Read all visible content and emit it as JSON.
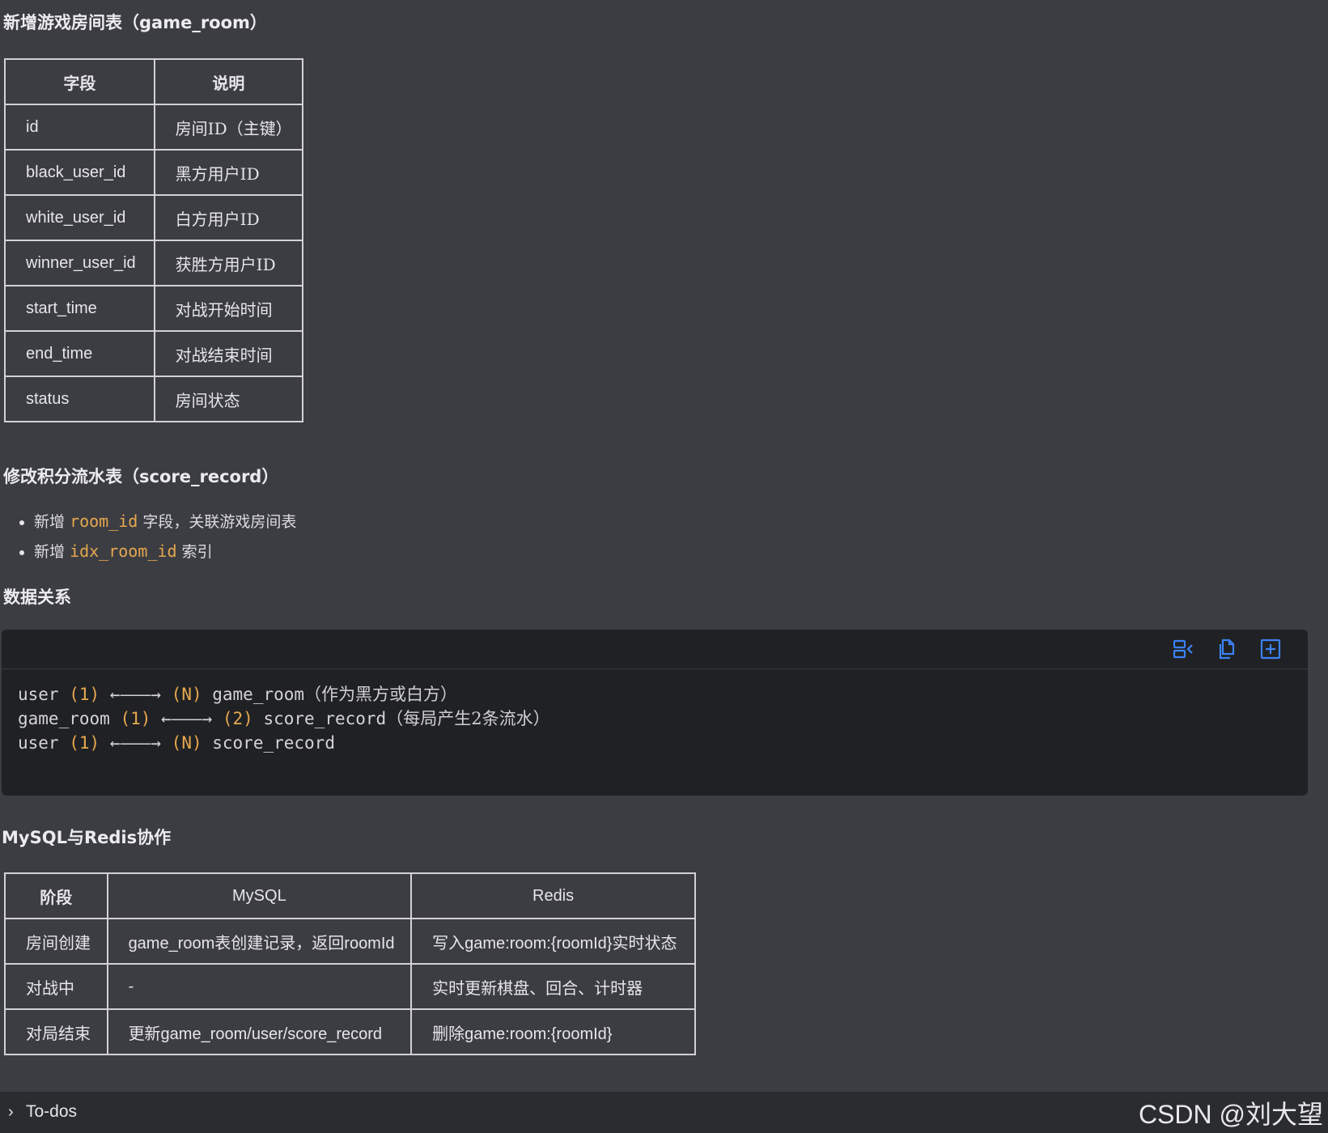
{
  "sections": {
    "game_room_title": "新增游戏房间表（game_room）",
    "score_title": "修改积分流水表（score_record）",
    "relations_title": "数据关系",
    "mysql_redis_title": "MySQL与Redis协作"
  },
  "game_room_table": {
    "headers": [
      "字段",
      "说明"
    ],
    "rows": [
      [
        "id",
        "房间ID（主键）"
      ],
      [
        "black_user_id",
        "黑方用户ID"
      ],
      [
        "white_user_id",
        "白方用户ID"
      ],
      [
        "winner_user_id",
        "获胜方用户ID"
      ],
      [
        "start_time",
        "对战开始时间"
      ],
      [
        "end_time",
        "对战结束时间"
      ],
      [
        "status",
        "房间状态"
      ]
    ]
  },
  "score_bullets": [
    {
      "prefix": "新增",
      "code": "room_id",
      "suffix": "字段，关联游戏房间表"
    },
    {
      "prefix": "新增",
      "code": "idx_room_id",
      "suffix": "索引"
    }
  ],
  "code_block": {
    "toolbar_icons": [
      "wrap-lines-icon",
      "copy-icon",
      "expand-icon"
    ],
    "lines": [
      {
        "a": "user ",
        "na": "(1)",
        "arrow": " ←———→ ",
        "nb": "(N)",
        "b": " game_room",
        "note": "（作为黑方或白方）"
      },
      {
        "a": "game_room ",
        "na": "(1)",
        "arrow": " ←———→ ",
        "nb": "(2)",
        "b": " score_record",
        "note": "（每局产生2条流水）"
      },
      {
        "a": "user ",
        "na": "(1)",
        "arrow": " ←———→ ",
        "nb": "(N)",
        "b": " score_record",
        "note": ""
      }
    ]
  },
  "mysql_redis_table": {
    "headers": [
      "阶段",
      "MySQL",
      "Redis"
    ],
    "rows": [
      [
        "房间创建",
        "game_room表创建记录，返回roomId",
        "写入game:room:{roomId}实时状态"
      ],
      [
        "对战中",
        "-",
        "实时更新棋盘、回合、计时器"
      ],
      [
        "对局结束",
        "更新game_room/user/score_record",
        "删除game:room:{roomId}"
      ]
    ]
  },
  "footer": {
    "todos_label": "To-dos",
    "watermark": "CSDN @刘大望"
  }
}
